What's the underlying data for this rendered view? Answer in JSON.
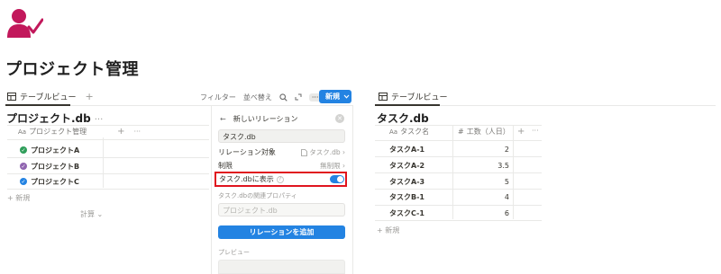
{
  "page": {
    "title": "プロジェクト管理",
    "icon": "user-check-icon"
  },
  "left_view": {
    "tab_label": "テーブルビュー",
    "add_view": "+",
    "toolbar": {
      "filter": "フィルター",
      "sort": "並べ替え",
      "more": "···",
      "new_label": "新規"
    },
    "db_title": "プロジェクト.db",
    "db_menu": "···",
    "column_prefix": "Aa",
    "column_name": "プロジェクト管理",
    "add_column": "+",
    "column_menu": "···",
    "rows": [
      {
        "label": "プロジェクトA",
        "color": "#2f9e5a"
      },
      {
        "label": "プロジェクトB",
        "color": "#9065b0"
      },
      {
        "label": "プロジェクトC",
        "color": "#2383e2"
      }
    ],
    "new_row": "+ 新規",
    "calculate": "計算 ⌄"
  },
  "relation_panel": {
    "back": "←",
    "title": "新しいリレーション",
    "close": "✕",
    "name_value": "タスク.db",
    "relation_target_label": "リレーション対象",
    "relation_target_value": "タスク.db ›",
    "limit_label": "制限",
    "limit_value": "無制限 ›",
    "show_on_label": "タスク.dbに表示",
    "show_on_enabled": true,
    "related_property_label": "タスク.dbの関連プロパティ",
    "related_property_placeholder": "プロジェクト.db",
    "add_button": "リレーションを追加",
    "preview_label": "プレビュー"
  },
  "right_view": {
    "tab_label": "テーブルビュー",
    "db_title": "タスク.db",
    "col1_prefix": "Aa",
    "col1_name": "タスク名",
    "col2_prefix": "#",
    "col2_name": "工数（人日）",
    "add_column": "+",
    "column_menu": "···",
    "rows": [
      {
        "name": "タスクA-1",
        "value": "2"
      },
      {
        "name": "タスクA-2",
        "value": "3.5"
      },
      {
        "name": "タスクA-3",
        "value": "5"
      },
      {
        "name": "タスクB-1",
        "value": "4"
      },
      {
        "name": "タスクC-1",
        "value": "6"
      }
    ],
    "new_row": "+ 新規"
  },
  "colors": {
    "accent": "#2383e2",
    "highlight": "#e0141e",
    "icon_pink": "#c2185b"
  }
}
